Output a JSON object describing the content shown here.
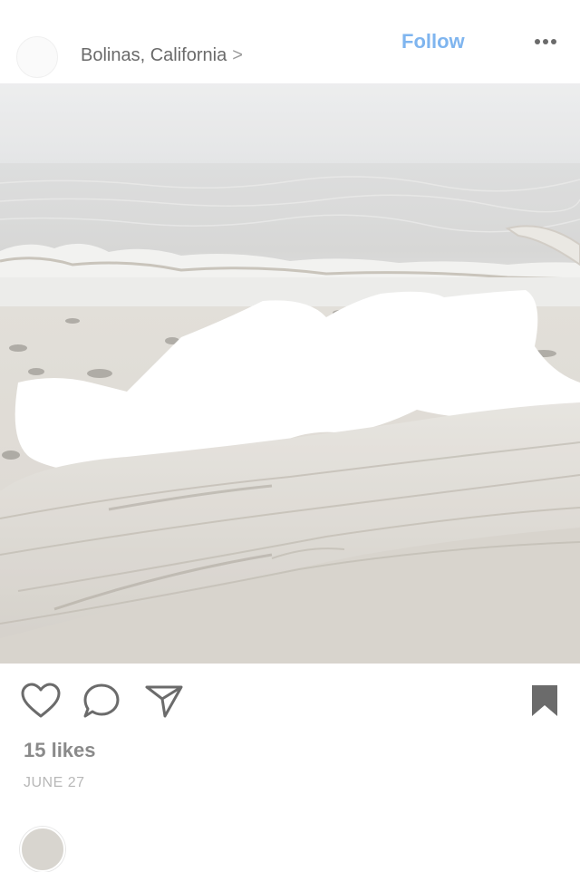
{
  "header": {
    "location": "Bolinas, California",
    "location_chevron": ">",
    "follow_label": "Follow",
    "more_icon": "more-horizontal-icon"
  },
  "post": {
    "image_description_icon": "photo",
    "likes": "15 likes",
    "date": "JUNE 27"
  },
  "actions": {
    "like_icon": "heart-icon",
    "comment_icon": "comment-icon",
    "share_icon": "send-icon",
    "save_icon": "bookmark-icon"
  },
  "colors": {
    "follow": "#7fb5ef",
    "text_muted": "#6a6a6a",
    "icon": "#6b6b6b"
  }
}
